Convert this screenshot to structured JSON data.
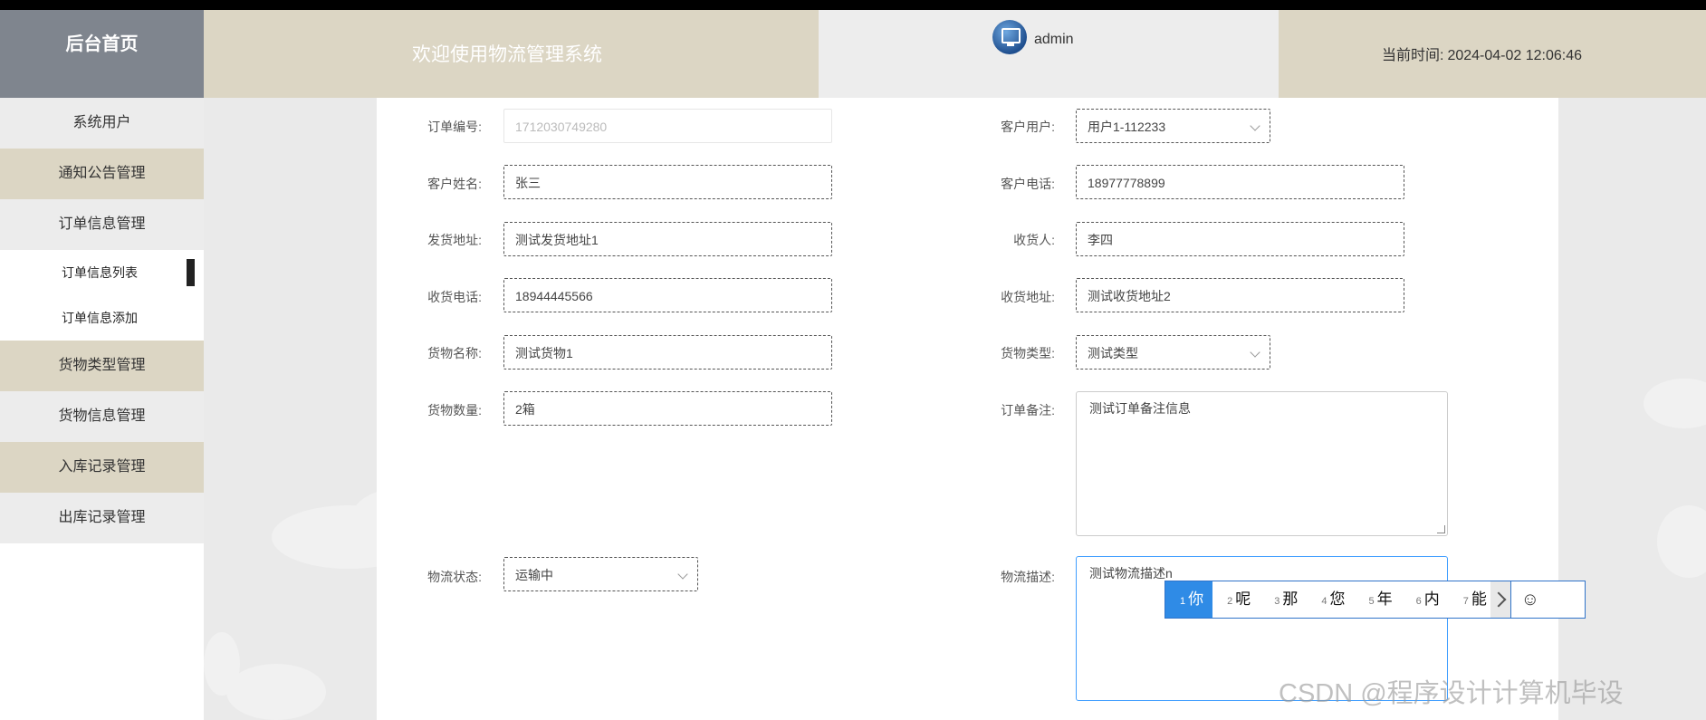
{
  "header": {
    "brand": "后台首页",
    "welcome": "欢迎使用物流管理系统",
    "username": "admin",
    "time_label": "当前时间:",
    "time_value": "2024-04-02 12:06:46"
  },
  "sidebar": {
    "items": [
      {
        "label": "系统用户"
      },
      {
        "label": "通知公告管理"
      },
      {
        "label": "订单信息管理"
      },
      {
        "label": "订单信息列表"
      },
      {
        "label": "订单信息添加"
      },
      {
        "label": "货物类型管理"
      },
      {
        "label": "货物信息管理"
      },
      {
        "label": "入库记录管理"
      },
      {
        "label": "出库记录管理"
      }
    ]
  },
  "form": {
    "order_no": {
      "label": "订单编号:",
      "value": "1712030749280"
    },
    "customer_user": {
      "label": "客户用户:",
      "value": "用户1-112233"
    },
    "customer_name": {
      "label": "客户姓名:",
      "value": "张三"
    },
    "customer_phone": {
      "label": "客户电话:",
      "value": "18977778899"
    },
    "ship_address": {
      "label": "发货地址:",
      "value": "测试发货地址1"
    },
    "receiver": {
      "label": "收货人:",
      "value": "李四"
    },
    "receiver_phone": {
      "label": "收货电话:",
      "value": "18944445566"
    },
    "receive_address": {
      "label": "收货地址:",
      "value": "测试收货地址2"
    },
    "goods_name": {
      "label": "货物名称:",
      "value": "测试货物1"
    },
    "goods_type": {
      "label": "货物类型:",
      "value": "测试类型"
    },
    "goods_qty": {
      "label": "货物数量:",
      "value": "2箱"
    },
    "order_note": {
      "label": "订单备注:",
      "value": "测试订单备注信息"
    },
    "logistics_status": {
      "label": "物流状态:",
      "value": "运输中"
    },
    "logistics_desc": {
      "label": "物流描述:",
      "value": "测试物流描述n"
    }
  },
  "ime": {
    "candidates": [
      {
        "num": "1",
        "text": "你"
      },
      {
        "num": "2",
        "text": "呢"
      },
      {
        "num": "3",
        "text": "那"
      },
      {
        "num": "4",
        "text": "您"
      },
      {
        "num": "5",
        "text": "年"
      },
      {
        "num": "6",
        "text": "内"
      },
      {
        "num": "7",
        "text": "能"
      }
    ],
    "emoji": "☺"
  },
  "watermark": "CSDN @程序设计计算机毕设"
}
